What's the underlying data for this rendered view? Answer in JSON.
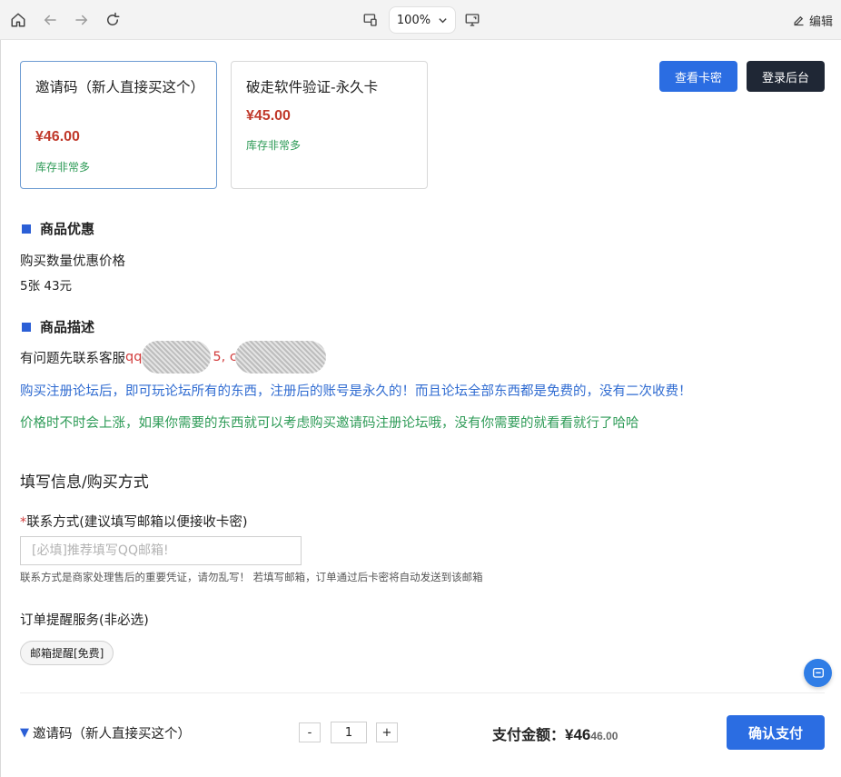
{
  "toolbar": {
    "zoom": "100%",
    "edit_label": "编辑"
  },
  "products": [
    {
      "name": "邀请码（新人直接买这个）",
      "price": "¥46.00",
      "stock": "库存非常多",
      "selected": true
    },
    {
      "name": "破走软件验证-永久卡",
      "price": "¥45.00",
      "stock": "库存非常多",
      "selected": false
    }
  ],
  "header_buttons": {
    "view_cards": "查看卡密",
    "login_admin": "登录后台"
  },
  "discount": {
    "title": "商品优惠",
    "label": "购买数量优惠价格",
    "rule": "5张 43元"
  },
  "description": {
    "title": "商品描述",
    "contact_prefix": "有问题先联系客服",
    "contact_red_1": "qq",
    "contact_red_2": "5, c",
    "line_blue": "购买注册论坛后，即可玩论坛所有的东西，注册后的账号是永久的！而且论坛全部东西都是免费的，没有二次收费！",
    "line_green": "价格时不时会上涨，如果你需要的东西就可以考虑购买邀请码注册论坛哦，没有你需要的就看看就行了哈哈"
  },
  "form": {
    "heading": "填写信息/购买方式",
    "contact_label_star": "*",
    "contact_label": "联系方式(建议填写邮箱以便接收卡密)",
    "contact_placeholder": "[必填]推荐填写QQ邮箱!",
    "contact_value": "",
    "contact_hint": "联系方式是商家处理售后的重要凭证，请勿乱写！ 若填写邮箱，订单通过后卡密将自动发送到该邮箱",
    "reminder_label": "订单提醒服务(非必选)",
    "reminder_option": "邮箱提醒[免费]"
  },
  "order": {
    "summary_arrow": "▼",
    "summary_name": "邀请码（新人直接买这个）",
    "qty_minus": "-",
    "quantity": "1",
    "qty_plus": "+",
    "pay_label": "支付金额：",
    "pay_amount": "¥46",
    "pay_original": "46.00",
    "confirm": "确认支付"
  },
  "colors": {
    "primary": "#2b6de2",
    "dark_button": "#1f2735",
    "price_red": "#c0392b",
    "stock_green": "#2e9b57",
    "desc_blue": "#2f6bd1"
  }
}
